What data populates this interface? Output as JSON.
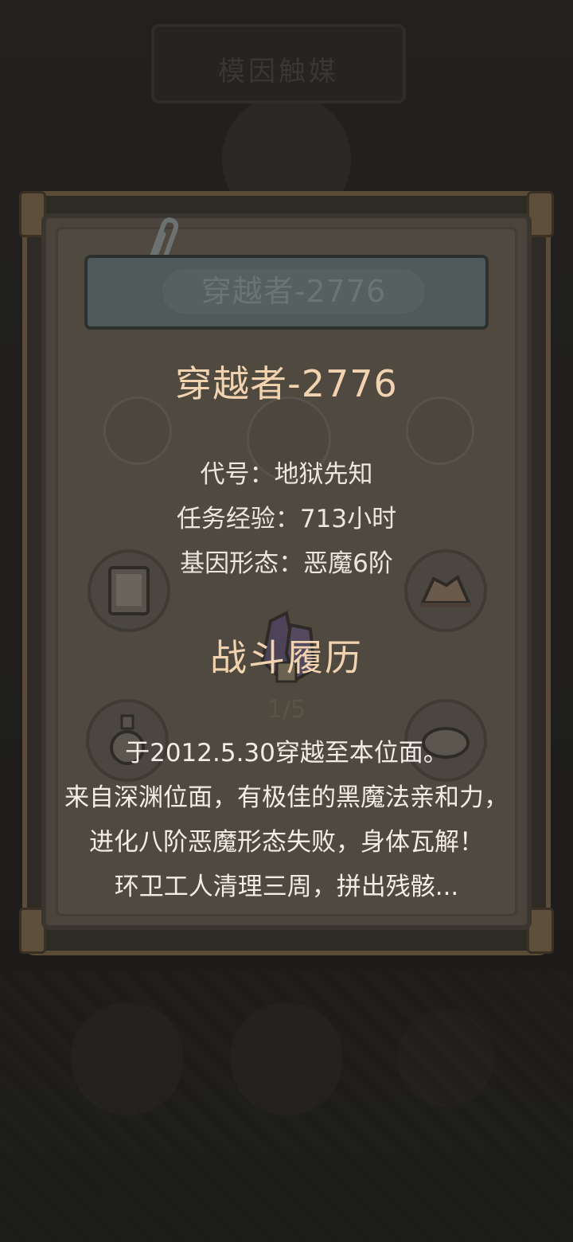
{
  "background": {
    "banner_text": "模因触媒",
    "progress_text": "1/5"
  },
  "card": {
    "header_label": "穿越者-2776",
    "name": "穿越者-2776",
    "info": {
      "codename": "代号：地狱先知",
      "mission_exp": "任务经验：713小时",
      "gene_form": "基因形态：恶魔6阶"
    },
    "history_title": "战斗履历",
    "history_lines": [
      "于2012.5.30穿越至本位面。",
      "来自深渊位面，有极佳的黑魔法亲和力，",
      "进化八阶恶魔形态失败，身体瓦解！",
      "环卫工人清理三周，拼出残骸..."
    ]
  },
  "colors": {
    "accent_title": "#f2d3b0",
    "body_text": "#ece6dc",
    "overlay": "#1f1e1c"
  }
}
